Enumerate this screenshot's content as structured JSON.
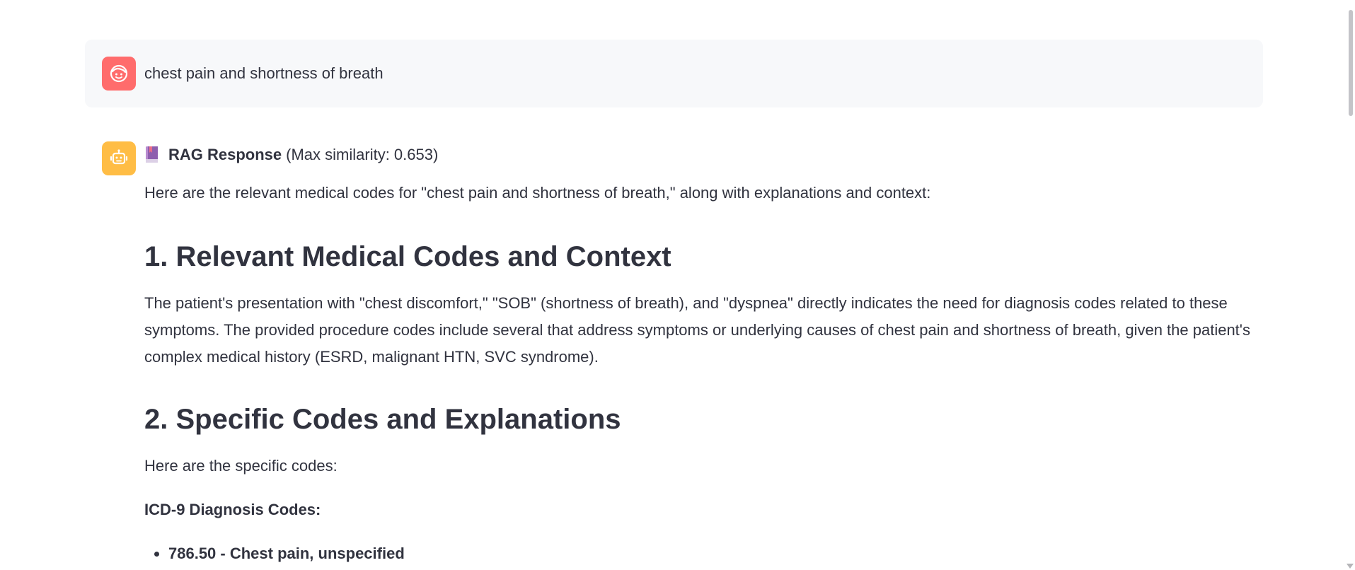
{
  "user_message": {
    "text": "chest pain and shortness of breath",
    "avatar_icon": "face-icon",
    "avatar_color": "#ff6c6c"
  },
  "assistant_message": {
    "avatar_icon": "robot-icon",
    "avatar_color": "#ffbd45",
    "header_icon": "book-icon",
    "header_bold": "RAG Response",
    "header_rest": "(Max similarity: 0.653)",
    "intro": "Here are the relevant medical codes for \"chest pain and shortness of breath,\" along with explanations and context:",
    "section1_title": "1. Relevant Medical Codes and Context",
    "section1_text": "The patient's presentation with \"chest discomfort,\" \"SOB\" (shortness of breath), and \"dyspnea\" directly indicates the need for diagnosis codes related to these symptoms. The provided procedure codes include several that address symptoms or underlying causes of chest pain and shortness of breath, given the patient's complex medical history (ESRD, malignant HTN, SVC syndrome).",
    "section2_title": "2. Specific Codes and Explanations",
    "section2_text": "Here are the specific codes:",
    "subheading": "ICD-9 Diagnosis Codes:",
    "codes": [
      "786.50 - Chest pain, unspecified"
    ]
  }
}
